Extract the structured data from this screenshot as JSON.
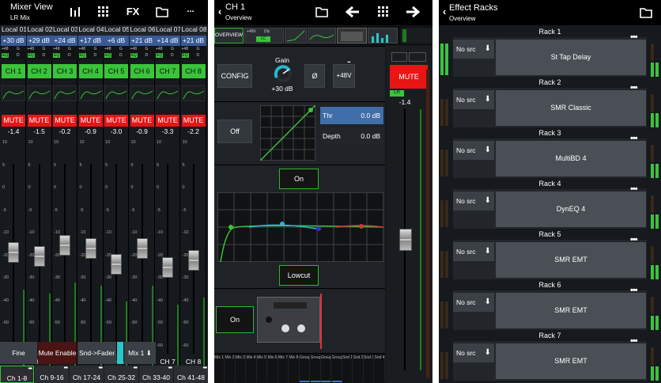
{
  "mixer_view": {
    "title": "Mixer View",
    "subtitle": "LR Mix",
    "toolbar": {
      "fx_label": "FX",
      "more_label": "..."
    },
    "strips": [
      {
        "local": "Local 01",
        "gain": "+30 dB",
        "ch": "CH 1",
        "fader_db": "-1.4",
        "name": "CH 1",
        "level": 0.42
      },
      {
        "local": "Local 02",
        "gain": "+29 dB",
        "ch": "CH 2",
        "fader_db": "-1.5",
        "name": "CH 2",
        "level": 0.4
      },
      {
        "local": "Local 03",
        "gain": "+24 dB",
        "ch": "CH 3",
        "fader_db": "-0.2",
        "name": "CH 3",
        "level": 0.46
      },
      {
        "local": "Local 04",
        "gain": "+17 dB",
        "ch": "CH 4",
        "fader_db": "-0.9",
        "name": "CH 4",
        "level": 0.44
      },
      {
        "local": "Local 05",
        "gain": "+6 dB",
        "ch": "CH 5",
        "fader_db": "-3.0",
        "name": "CH 5",
        "level": 0.36
      },
      {
        "local": "Local 06",
        "gain": "+21 dB",
        "ch": "CH 6",
        "fader_db": "-0.9",
        "name": "CH 6",
        "level": 0.44
      },
      {
        "local": "Local 07",
        "gain": "+14 dB",
        "ch": "CH 7",
        "fader_db": "-3.3",
        "name": "CH 7",
        "level": 0.34
      },
      {
        "local": "Local 08",
        "gain": "+21 dB",
        "ch": "CH 8",
        "fader_db": "-2.2",
        "name": "CH 8",
        "level": 0.38
      }
    ],
    "mini_labels": {
      "phantom": "+48",
      "gate": "G",
      "eq": "EQ",
      "dyn": "D"
    },
    "mute_label": "MUTE",
    "scale": [
      "10",
      "5",
      "0",
      "-5",
      "-10",
      "-20",
      "-30",
      "-40",
      "-50",
      "-60"
    ],
    "buttons": {
      "fine": "Fine",
      "mute_enable": "Mute Enable",
      "snd_fader": "Snd->Fader",
      "mix1": "Mix 1"
    },
    "banks": [
      "Ch 1-8",
      "Ch 9-16",
      "Ch 17-24",
      "Ch 25-32",
      "Ch 33-40",
      "Ch 41-48"
    ],
    "colors": {
      "accent": "#3ac43a",
      "mute": "#e81515",
      "gain": "#3a5a94"
    }
  },
  "channel": {
    "title": "CH 1",
    "subtitle": "Overview",
    "tabs": [
      "OVERVIEW",
      "+48V",
      "Dly",
      "LC",
      "GATE",
      "EQ",
      "COMP",
      "SEND"
    ],
    "config_label": "CONFIG",
    "gain_label": "Gain",
    "gain_value": "+30 dB",
    "gain_fraction": 0.75,
    "phase_label": "Ø",
    "phantom_label": "+48V",
    "gate_off_label": "Off",
    "thr_label": "Thr",
    "thr_value": "0.0 dB",
    "depth_label": "Depth",
    "depth_value": "0.0 dB",
    "eq_on_label": "On",
    "lowcut_label": "Lowcut",
    "fx_on_label": "On",
    "mute_label": "MUTE",
    "lr_label": "LR",
    "fader_db": "-1.4",
    "fader_level": 0.42,
    "sends": [
      "Mix 1",
      "Mix 2",
      "Mix 3",
      "Mix 4",
      "Mix 5",
      "Mix 6",
      "Mix 7",
      "Mix 8",
      "Group 1",
      "Group 2",
      "Group 3",
      "Group 4",
      "Snd 1",
      "Snd 2",
      "Snd 3",
      "Snd 4"
    ]
  },
  "racks": {
    "title": "Effect Racks",
    "subtitle": "Overview",
    "no_src_label": "No src",
    "items": [
      {
        "name": "Rack 1",
        "fx": "St Tap Delay"
      },
      {
        "name": "Rack 2",
        "fx": "SMR Classic"
      },
      {
        "name": "Rack 3",
        "fx": "MultiBD 4"
      },
      {
        "name": "Rack 4",
        "fx": "DynEQ 4"
      },
      {
        "name": "Rack 5",
        "fx": "SMR EMT"
      },
      {
        "name": "Rack 6",
        "fx": "SMR EMT"
      },
      {
        "name": "Rack 7",
        "fx": "SMR EMT"
      }
    ]
  }
}
